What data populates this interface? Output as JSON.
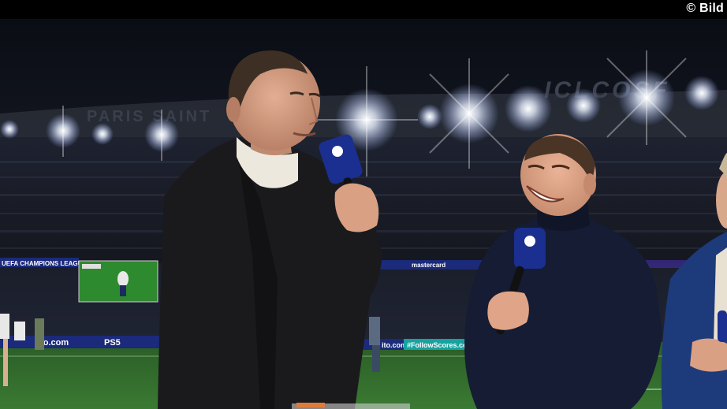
{
  "credit": "© Bild",
  "stadium": {
    "roof_text_left": "PARIS SAINT",
    "roof_text_right": "ICLCOSF"
  },
  "boards": {
    "left_upper": "UEFA CHAMPIONS LEAGUE",
    "center_upper": "mastercard",
    "left_lower": "ito.com",
    "ps5": "PS5",
    "center_lower": "ito.com",
    "right_lower": "#FollowScores.com"
  },
  "colors": {
    "pitch": "#2f6b2a",
    "board_blue": "#1b2a7a",
    "mic_blue": "#1a2f8f",
    "sweater_navy": "#151c33",
    "coat_black": "#1a1a1d"
  },
  "icons": [
    "stadium-light-icon",
    "microphone-icon",
    "champions-league-star-icon"
  ]
}
